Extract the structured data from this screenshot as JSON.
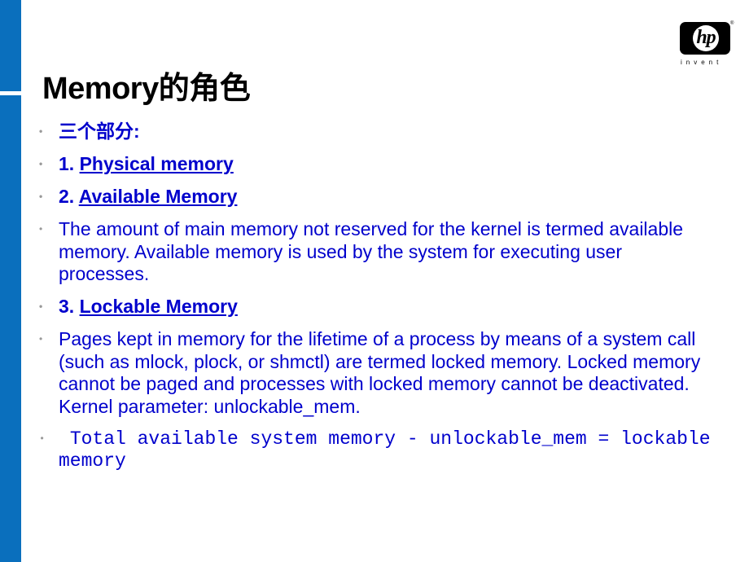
{
  "slide": {
    "title": "Memory的角色",
    "logo": {
      "brand": "hp",
      "tagline": "invent",
      "registered_mark": "®"
    },
    "bullets": [
      {
        "prefix": "三个部分:",
        "link": ""
      },
      {
        "prefix": "1. ",
        "link": "Physical memory"
      },
      {
        "prefix": "2. ",
        "link": "Available Memory"
      },
      {
        "text": "The amount of main memory not reserved for the kernel is termed available memory. Available memory is used by the system for executing user processes."
      },
      {
        "prefix": "3. ",
        "link": "Lockable Memory"
      },
      {
        "text": "Pages kept in memory for the lifetime of a process by means of a system call (such as mlock, plock, or shmctl) are termed locked memory. Locked memory cannot be paged and processes with locked memory cannot be deactivated. Kernel parameter: unlockable_mem."
      },
      {
        "text": " Total available system memory - unlockable_mem = lockable memory"
      }
    ],
    "bullet_glyph": "•"
  }
}
